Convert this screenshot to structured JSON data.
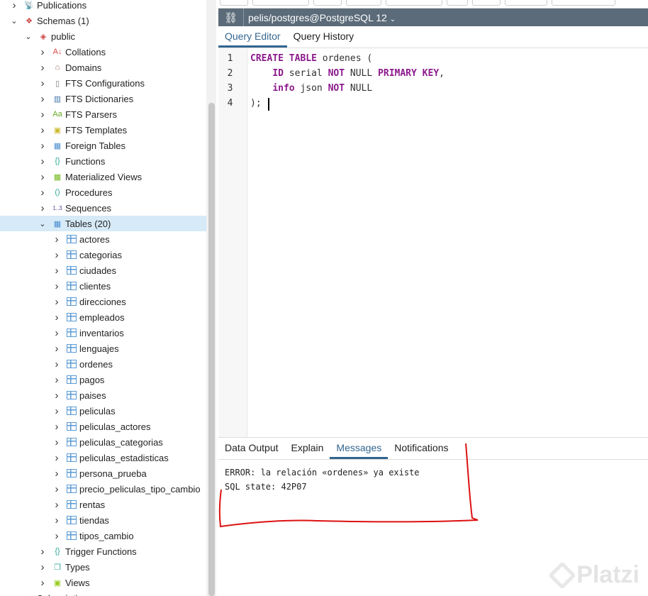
{
  "tree": [
    {
      "label": "Publications",
      "level": 0,
      "state": "collapsed",
      "icon": "publication-icon"
    },
    {
      "label": "Schemas (1)",
      "level": 0,
      "state": "expanded",
      "icon": "schemas-icon"
    },
    {
      "label": "public",
      "level": 1,
      "state": "expanded",
      "icon": "schema-icon"
    },
    {
      "label": "Collations",
      "level": 2,
      "state": "collapsed",
      "icon": "collation-icon"
    },
    {
      "label": "Domains",
      "level": 2,
      "state": "collapsed",
      "icon": "domain-icon"
    },
    {
      "label": "FTS Configurations",
      "level": 2,
      "state": "collapsed",
      "icon": "fts-configuration-icon"
    },
    {
      "label": "FTS Dictionaries",
      "level": 2,
      "state": "collapsed",
      "icon": "fts-dictionary-icon"
    },
    {
      "label": "FTS Parsers",
      "level": 2,
      "state": "collapsed",
      "icon": "fts-parser-icon"
    },
    {
      "label": "FTS Templates",
      "level": 2,
      "state": "collapsed",
      "icon": "fts-template-icon"
    },
    {
      "label": "Foreign Tables",
      "level": 2,
      "state": "collapsed",
      "icon": "foreign-table-icon"
    },
    {
      "label": "Functions",
      "level": 2,
      "state": "collapsed",
      "icon": "function-icon"
    },
    {
      "label": "Materialized Views",
      "level": 2,
      "state": "collapsed",
      "icon": "materialized-view-icon"
    },
    {
      "label": "Procedures",
      "level": 2,
      "state": "collapsed",
      "icon": "procedure-icon"
    },
    {
      "label": "Sequences",
      "level": 2,
      "state": "collapsed",
      "icon": "sequence-icon"
    },
    {
      "label": "Tables (20)",
      "level": 2,
      "state": "expanded",
      "icon": "tables-icon",
      "selected": true
    },
    {
      "label": "actores",
      "level": 3,
      "state": "collapsed",
      "icon": "table-icon"
    },
    {
      "label": "categorias",
      "level": 3,
      "state": "collapsed",
      "icon": "table-icon"
    },
    {
      "label": "ciudades",
      "level": 3,
      "state": "collapsed",
      "icon": "table-icon"
    },
    {
      "label": "clientes",
      "level": 3,
      "state": "collapsed",
      "icon": "table-icon"
    },
    {
      "label": "direcciones",
      "level": 3,
      "state": "collapsed",
      "icon": "table-icon"
    },
    {
      "label": "empleados",
      "level": 3,
      "state": "collapsed",
      "icon": "table-icon"
    },
    {
      "label": "inventarios",
      "level": 3,
      "state": "collapsed",
      "icon": "table-icon"
    },
    {
      "label": "lenguajes",
      "level": 3,
      "state": "collapsed",
      "icon": "table-icon"
    },
    {
      "label": "ordenes",
      "level": 3,
      "state": "collapsed",
      "icon": "table-icon"
    },
    {
      "label": "pagos",
      "level": 3,
      "state": "collapsed",
      "icon": "table-icon"
    },
    {
      "label": "paises",
      "level": 3,
      "state": "collapsed",
      "icon": "table-icon"
    },
    {
      "label": "peliculas",
      "level": 3,
      "state": "collapsed",
      "icon": "table-icon"
    },
    {
      "label": "peliculas_actores",
      "level": 3,
      "state": "collapsed",
      "icon": "table-icon"
    },
    {
      "label": "peliculas_categorias",
      "level": 3,
      "state": "collapsed",
      "icon": "table-icon"
    },
    {
      "label": "peliculas_estadisticas",
      "level": 3,
      "state": "collapsed",
      "icon": "table-icon"
    },
    {
      "label": "persona_prueba",
      "level": 3,
      "state": "collapsed",
      "icon": "table-icon"
    },
    {
      "label": "precio_peliculas_tipo_cambio",
      "level": 3,
      "state": "collapsed",
      "icon": "table-icon"
    },
    {
      "label": "rentas",
      "level": 3,
      "state": "collapsed",
      "icon": "table-icon"
    },
    {
      "label": "tiendas",
      "level": 3,
      "state": "collapsed",
      "icon": "table-icon"
    },
    {
      "label": "tipos_cambio",
      "level": 3,
      "state": "collapsed",
      "icon": "table-icon"
    },
    {
      "label": "Trigger Functions",
      "level": 2,
      "state": "collapsed",
      "icon": "trigger-function-icon"
    },
    {
      "label": "Types",
      "level": 2,
      "state": "collapsed",
      "icon": "type-icon"
    },
    {
      "label": "Views",
      "level": 2,
      "state": "collapsed",
      "icon": "view-icon"
    },
    {
      "label": "Subscriptions",
      "level": 0,
      "state": "collapsed",
      "icon": "subscription-icon"
    }
  ],
  "connection": {
    "label": "pelis/postgres@PostgreSQL 12",
    "icon": "connection-icon"
  },
  "editor_tabs": [
    "Query Editor",
    "Query History"
  ],
  "code_lines": [
    [
      {
        "t": "CREATE TABLE",
        "k": 1
      },
      {
        "t": " ordenes (",
        "k": 0
      }
    ],
    [
      {
        "t": "    ",
        "k": 0
      },
      {
        "t": "ID",
        "k": 1
      },
      {
        "t": " serial ",
        "k": 0
      },
      {
        "t": "NOT",
        "k": 1
      },
      {
        "t": " NULL ",
        "k": 0
      },
      {
        "t": "PRIMARY KEY",
        "k": 1
      },
      {
        "t": ",",
        "k": 0
      }
    ],
    [
      {
        "t": "    ",
        "k": 0
      },
      {
        "t": "info",
        "k": 1
      },
      {
        "t": " json ",
        "k": 0
      },
      {
        "t": "NOT",
        "k": 1
      },
      {
        "t": " NULL",
        "k": 0
      }
    ],
    [
      {
        "t": ");",
        "k": 0
      }
    ]
  ],
  "line_numbers": [
    "1",
    "2",
    "3",
    "4"
  ],
  "output_tabs": [
    "Data Output",
    "Explain",
    "Messages",
    "Notifications"
  ],
  "active_output_tab": 2,
  "messages": [
    "ERROR:  la relación «ordenes» ya existe",
    "SQL state: 42P07"
  ],
  "watermark": "Platzi"
}
